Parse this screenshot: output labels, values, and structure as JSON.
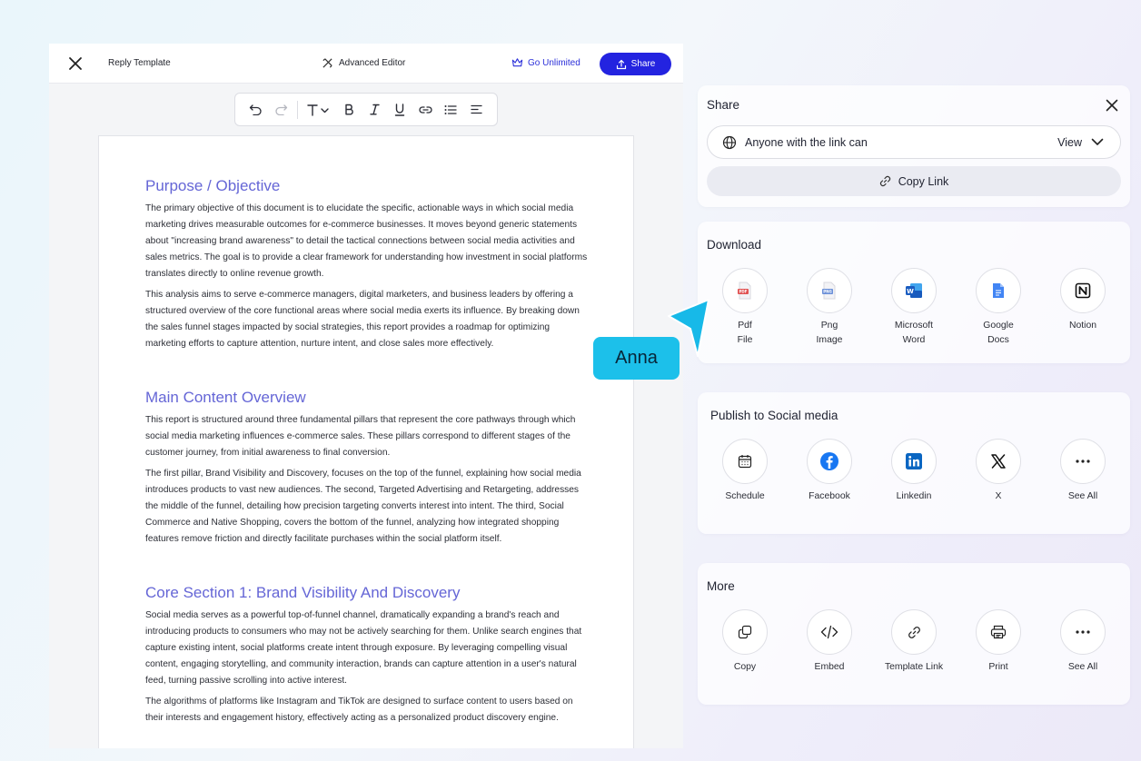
{
  "editor": {
    "title": "Reply Template",
    "advanced_editor": "Advanced Editor",
    "go_unlimited": "Go Unlimited",
    "share_label": "Share",
    "document": {
      "sections": [
        {
          "heading": "Purpose / Objective",
          "paragraphs": [
            "The primary objective of this document is to elucidate the specific, actionable ways in which social media marketing drives measurable outcomes for e-commerce businesses. It moves beyond generic statements about \"increasing brand awareness\" to detail the tactical connections between social media activities and sales metrics. The goal is to provide a clear framework for understanding how investment in social platforms translates directly to online revenue growth.",
            "This analysis aims to serve e-commerce managers, digital marketers, and business leaders by offering a structured overview of the core functional areas where social media exerts its influence. By breaking down the sales funnel stages impacted by social strategies, this report provides a roadmap for optimizing marketing efforts to capture attention, nurture intent, and close sales more effectively."
          ]
        },
        {
          "heading": "Main Content Overview",
          "paragraphs": [
            "This report is structured around three fundamental pillars that represent the core pathways through which social media marketing influences e-commerce sales. These pillars correspond to different stages of the customer journey, from initial awareness to final conversion.",
            "The first pillar, Brand Visibility and Discovery, focuses on the top of the funnel, explaining how social media introduces products to vast new audiences. The second, Targeted Advertising and Retargeting, addresses the middle of the funnel, detailing how precision targeting converts interest into intent. The third, Social Commerce and Native Shopping, covers the bottom of the funnel, analyzing how integrated shopping features remove friction and directly facilitate purchases within the social platform itself."
          ]
        },
        {
          "heading": "Core Section 1: Brand Visibility And Discovery",
          "paragraphs": [
            "Social media serves as a powerful top-of-funnel channel, dramatically expanding a brand's reach and introducing products to consumers who may not be actively searching for them. Unlike search engines that capture existing intent, social platforms create intent through exposure. By leveraging compelling visual content, engaging storytelling, and community interaction, brands can capture attention in a user's natural feed, turning passive scrolling into active interest.",
            "The algorithms of platforms like Instagram and TikTok are designed to surface content to users based on their interests and engagement history, effectively acting as a personalized product discovery engine."
          ]
        }
      ]
    }
  },
  "share_panel": {
    "title": "Share",
    "permission": "Anyone with the link can",
    "access": "View",
    "copy_link": "Copy Link"
  },
  "download": {
    "title": "Download",
    "items": [
      {
        "label_line1": "Pdf",
        "label_line2": "File",
        "icon": "pdf-file-icon"
      },
      {
        "label_line1": "Png",
        "label_line2": "Image",
        "icon": "png-image-icon"
      },
      {
        "label_line1": "Microsoft",
        "label_line2": "Word",
        "icon": "word-icon"
      },
      {
        "label_line1": "Google",
        "label_line2": "Docs",
        "icon": "google-docs-icon"
      },
      {
        "label_line1": "Notion",
        "label_line2": "",
        "icon": "notion-icon"
      }
    ]
  },
  "publish": {
    "title": "Publish to Social media",
    "items": [
      {
        "label": "Schedule",
        "icon": "calendar-icon"
      },
      {
        "label": "Facebook",
        "icon": "facebook-icon"
      },
      {
        "label": "Linkedin",
        "icon": "linkedin-icon"
      },
      {
        "label": "X",
        "icon": "x-icon"
      },
      {
        "label": "See All",
        "icon": "more-icon"
      }
    ]
  },
  "more": {
    "title": "More",
    "items": [
      {
        "label": "Copy",
        "icon": "copy-icon"
      },
      {
        "label": "Embed",
        "icon": "code-icon"
      },
      {
        "label": "Template Link",
        "icon": "link-icon"
      },
      {
        "label": "Print",
        "icon": "printer-icon"
      },
      {
        "label": "See All",
        "icon": "more-icon"
      }
    ]
  },
  "collaborator": {
    "name": "Anna",
    "color": "#1cc0ea"
  },
  "colors": {
    "accent": "#2323e0",
    "heading": "#6566d6"
  }
}
